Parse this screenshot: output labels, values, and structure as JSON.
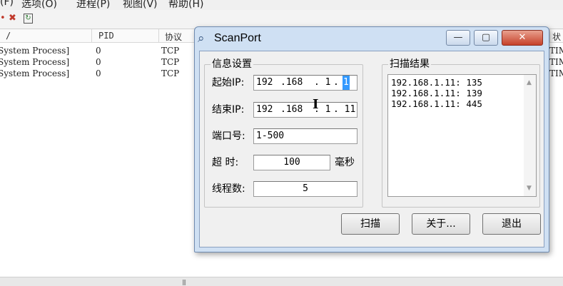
{
  "menubar": {
    "items": [
      "(F)",
      "选项(O)",
      "进程(P)",
      "视图(V)",
      "帮助(H)"
    ]
  },
  "toolbar": {
    "icons": [
      "close-icon",
      "kill-icon",
      "refresh-icon"
    ]
  },
  "bg_table": {
    "headers": [
      "/",
      "PID",
      "协议",
      "状"
    ],
    "rows": [
      {
        "name": "System Process]",
        "pid": "0",
        "proto": "TCP",
        "state": "TIM"
      },
      {
        "name": "System Process]",
        "pid": "0",
        "proto": "TCP",
        "state": "TIM"
      },
      {
        "name": "System Process]",
        "pid": "0",
        "proto": "TCP",
        "state": "TIM"
      }
    ]
  },
  "dialog": {
    "title": "ScanPort",
    "buttons": {
      "minimize": "—",
      "maximize": "▢",
      "close": "✕"
    },
    "settings": {
      "group_label": "信息设置",
      "start_ip_label": "起始IP:",
      "start_ip": {
        "o1": "192",
        "o2": ".168",
        "o3": ". 1",
        "o4_dot": ".",
        "o4": "1"
      },
      "end_ip_label": "结束IP:",
      "end_ip": {
        "o1": "192",
        "o2": ".168",
        "o3": ". 1",
        "o4": ". 11"
      },
      "port_label": "端口号:",
      "port_value": "1-500",
      "timeout_label": "超  时:",
      "timeout_value": "100",
      "timeout_unit": "毫秒",
      "threads_label": "线程数:",
      "threads_value": "5"
    },
    "results": {
      "group_label": "扫描结果",
      "lines": [
        "192.168.1.11: 135",
        "192.168.1.11: 139",
        "192.168.1.11: 445"
      ]
    },
    "actions": {
      "scan": "扫描",
      "about": "关于...",
      "exit": "退出"
    }
  },
  "colors": {
    "selection": "#3399ff",
    "dialog_frame": "#cfe0f3",
    "close_button": "#c6412a"
  }
}
